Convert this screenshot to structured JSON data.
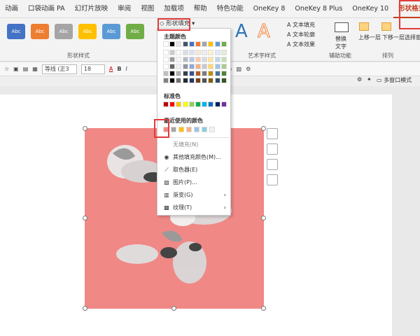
{
  "tabs": [
    "动画",
    "口袋动画 PA",
    "幻灯片放映",
    "审阅",
    "视图",
    "加载项",
    "帮助",
    "特色功能",
    "OneKey 8",
    "OneKey 8 Plus",
    "OneKey 10",
    "形状格式"
  ],
  "ribbon": {
    "shape_styles_label": "形状样式",
    "shape_btn_text": "Abc",
    "shape_colors": [
      "#4472c4",
      "#ed7d31",
      "#a5a5a5",
      "#ffc000",
      "#5b9bd5",
      "#70ad47"
    ],
    "shape_fill_label": "形状填充",
    "wordart_letter": "A",
    "wordart_label": "艺术字样式",
    "text_fill": "文本填充",
    "text_outline": "文本轮廓",
    "text_effect": "文本效果",
    "replace_text": "替换",
    "replace_text2": "文字",
    "assist_label": "辅助功能",
    "bring_forward": "上移一层",
    "send_backward": "下移一层",
    "selection_pane": "选择窗",
    "arrange_label": "排列"
  },
  "toolbar": {
    "font": "等线 (正3",
    "size": "18",
    "bold": "B",
    "italic": "I",
    "multi_window": "多窗口模式"
  },
  "popup": {
    "theme_colors_title": "主题颜色",
    "standard_colors_title": "标准色",
    "recent_colors_title": "最近使用的颜色",
    "no_fill": "无填充(N)",
    "more_colors": "其他填充颜色(M)...",
    "eyedropper": "取色器(E)",
    "picture": "图片(P)...",
    "gradient": "渐变(G)",
    "texture": "纹理(T)",
    "theme_top_row": [
      "#ffffff",
      "#000000",
      "#e7e6e6",
      "#44546a",
      "#4472c4",
      "#ed7d31",
      "#a5a5a5",
      "#ffc000",
      "#5b9bd5",
      "#70ad47"
    ],
    "standard_colors": [
      "#c00000",
      "#ff0000",
      "#ffc000",
      "#ffff00",
      "#92d050",
      "#00b050",
      "#00b0f0",
      "#0070c0",
      "#002060",
      "#7030a0"
    ],
    "recent_colors": [
      "#f08886",
      "#a5a5a5",
      "#ffc000",
      "#f4b183",
      "#9dc3e6",
      "#8ccfd8",
      "#f2f2f2"
    ]
  },
  "shape": {
    "fill": "#f08886"
  }
}
